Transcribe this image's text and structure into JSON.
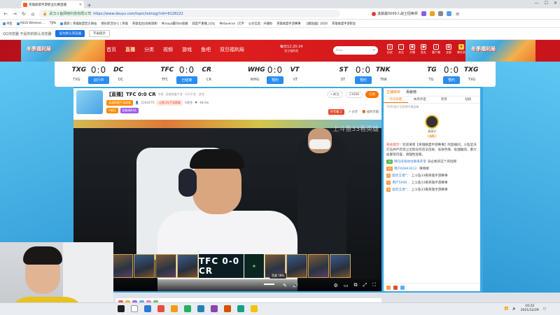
{
  "browser": {
    "tab_title": "英雄联盟手游职业比赛直播",
    "site_label": "武汉斗鱼网络科技有限公司",
    "url": "https://www.douyu.com/topic/lolmsjg?rid=9128222",
    "promo_text": "凌晨最5000人战士招唤师",
    "bookmarks": [
      "书签",
      "ASUS Wireless ...",
      "192.168.1.1/html",
      "TJPb",
      "最新 | 英雄联盟官方网站",
      "德乐新活动-1 | 英雄",
      "英雄电台|短视频和",
      "Minaya最同lol直播",
      "就是严重播_LOL|",
      "Metaverse（元宇",
      "公司信息：开播你",
      "英雄联盟手游赛事",
      "【播放器】2020",
      "英雄联盟手游职业",
      "手游..资讯...直播_LOL",
      "城市赛事手游"
    ],
    "infobar_msg": "QQ浏览器 不是你的默认浏览器",
    "infobar_primary": "设为默认浏览器",
    "infobar_secondary": "不再提示"
  },
  "sitenav": {
    "banner_text": "冬季福利局",
    "links": [
      "首页",
      "直播",
      "分类",
      "视频",
      "游戏",
      "鱼吧",
      "双旦福利局"
    ],
    "event_line1": "每日12.20-24",
    "event_line2": "双旦福利局",
    "search_placeholder": "Riao",
    "icons": [
      "历史",
      "关注",
      "开播",
      "鱼丸",
      "客户端",
      "全部",
      "做任务"
    ]
  },
  "scoreboard": [
    {
      "team_a": "TXG",
      "team_b": "DC",
      "logo_a": "TXG",
      "logo_b": "DC",
      "score": "0:0",
      "status": "进行中"
    },
    {
      "team_a": "TFC",
      "team_b": "CR",
      "logo_a": "TFC",
      "logo_b": "CR",
      "score": "0:0",
      "status": "已结束"
    },
    {
      "team_a": "WHG",
      "team_b": "VT",
      "logo_a": "WHG",
      "logo_b": "VT",
      "score": "0:0",
      "status": "预约"
    },
    {
      "team_a": "ST",
      "team_b": "TNK",
      "logo_a": "ST",
      "logo_b": "TNK",
      "score": "0:0",
      "status": "预约"
    },
    {
      "team_a": "TG",
      "team_b": "TXG",
      "logo_a": "TG",
      "logo_b": "TXG",
      "score": "0:0",
      "status": "预约"
    }
  ],
  "room": {
    "title": "【直播】TFC 0:0 CR",
    "tag": "举报",
    "category": "英雄联盟手游 · LOL手游 · 游戏",
    "streamer_badge": "英雄联盟手游赛事",
    "viewers": "2244270",
    "hot_chip": "斗鱼LOL手游赛事",
    "followers": "0关注",
    "fans": "48.6w",
    "level_chip": "V骑兵",
    "gift_chip": "超级福利站",
    "pill_share": "+关注",
    "pill_count": "13688",
    "pill_follow": "订阅",
    "right_gift": "开宝箱",
    "right_count": "2",
    "right_share": "分享",
    "right_report": "福利宝箱",
    "overlay_text": "上斗鱼33看英雄",
    "mid_score": "TFC 0-0 CR",
    "volume_tip": "音量 58%",
    "volume_level": 0.58
  },
  "side": {
    "tabs_head": [
      "主播榜单",
      "贡献榜"
    ],
    "tabs": [
      "今日亲密",
      "本周亲密",
      "贵宾",
      "钻粉"
    ],
    "rank_line": "TOP3用户可获得专属勋章",
    "top_user": "满满学",
    "top_level": "LV6",
    "sys_label": "系统提示",
    "sys_msg": "欢迎来到【英雄联盟手游赛事】的直播间。斗鱼坚决打击并严厉禁止出现任何违法违规、低俗色情、吸烟酗酒、暴力血腥等内容，请理性观看。",
    "chats": [
      {
        "lvl": "16",
        "nick": "哪吒闹海你也要来开宝",
        "msg": "没必要买这个风险啊"
      },
      {
        "lvl": "19",
        "nick": "用户66843012:",
        "msg": "嘻嘻嘻"
      },
      {
        "lvl": "3",
        "nick": "超巨王者*：",
        "msg": "上斗鱼33看英雄手游赛事"
      },
      {
        "lvl": "7",
        "nick": "用户5666...",
        "msg": "上斗鱼33看英雄手游赛事"
      },
      {
        "lvl": "9",
        "nick": "超巨王者*：",
        "msg": "上斗鱼33看英雄手游赛事"
      }
    ]
  },
  "taskbar": {
    "time": "16:22",
    "date": "2021/12/29"
  }
}
